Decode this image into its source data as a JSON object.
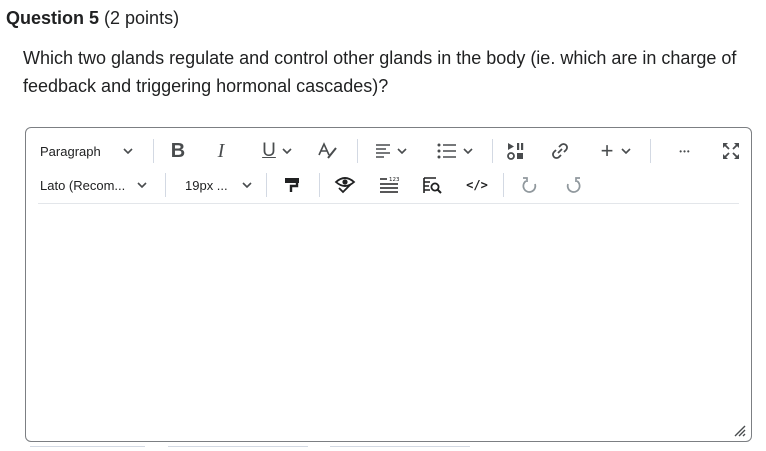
{
  "question": {
    "title": "Question 5",
    "points": "(2 points)",
    "text": "Which two glands regulate and control other glands in the body (ie. which are in charge of feedback and triggering hormonal cascades)?"
  },
  "toolbar": {
    "paragraph_label": "Paragraph",
    "font_label": "Lato (Recom...",
    "size_label": "19px ...",
    "bold_glyph": "B",
    "italic_glyph": "I",
    "underline_glyph": "U",
    "add_glyph": "+",
    "more_glyph": "•••",
    "code_glyph": "</>"
  },
  "colors": {
    "text": "#202122",
    "icon": "#494c4e",
    "border": "#7c7f83"
  },
  "editor": {
    "content": ""
  }
}
